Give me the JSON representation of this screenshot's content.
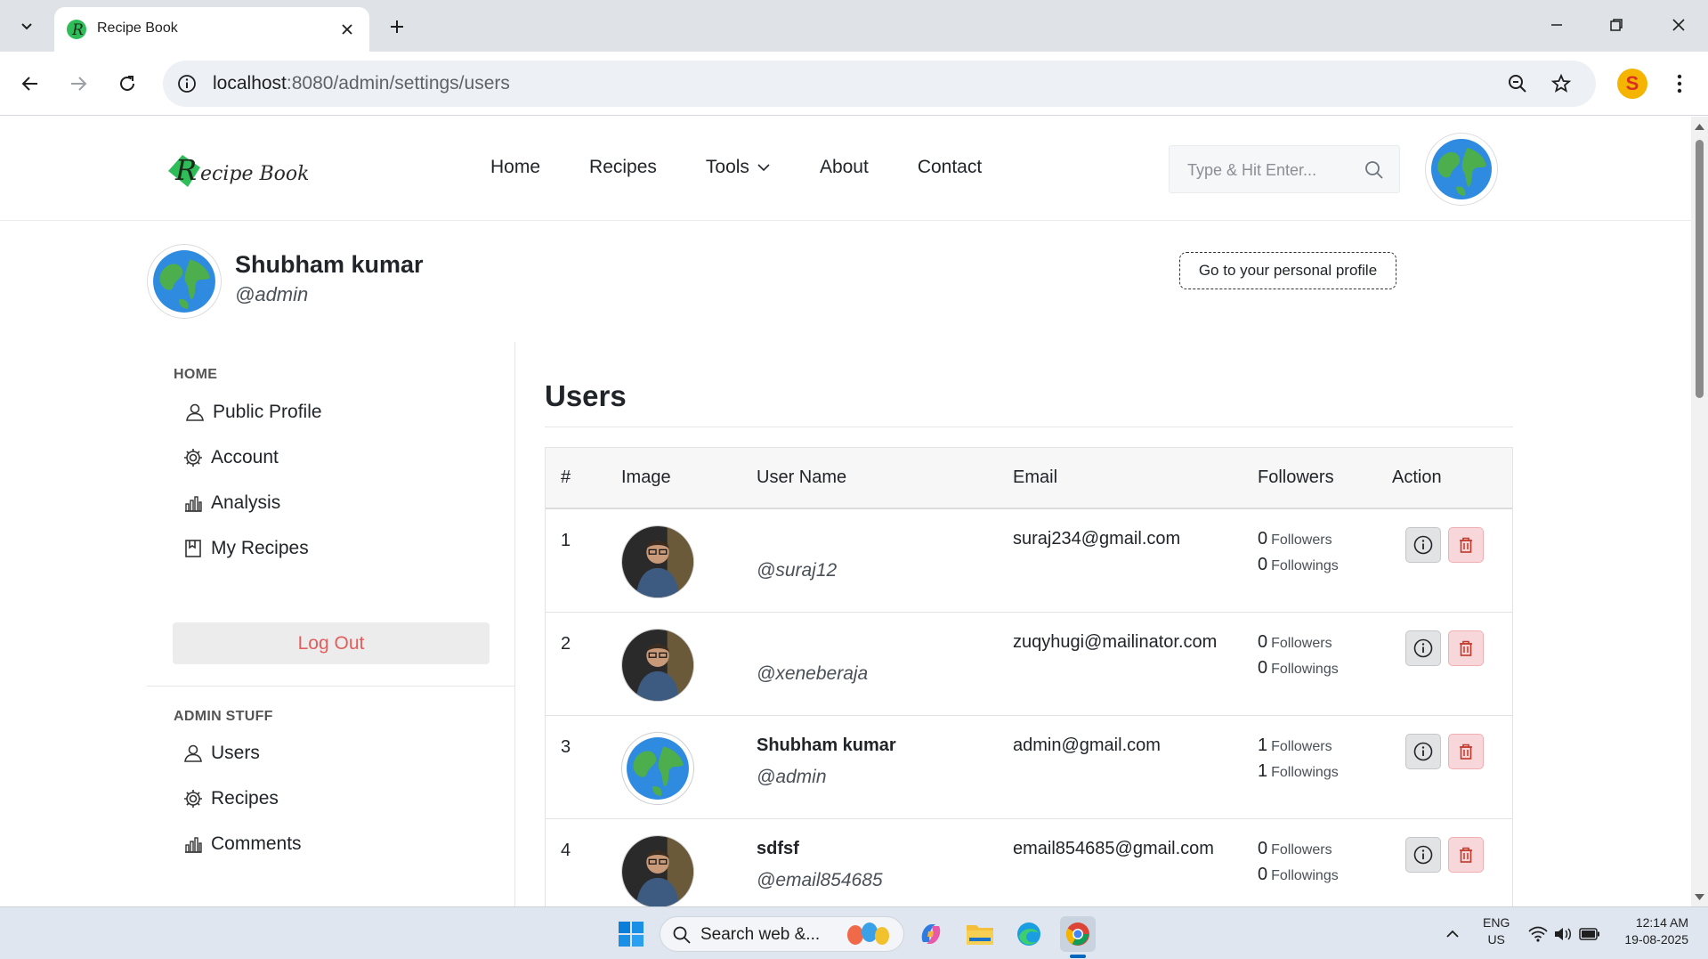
{
  "browser": {
    "tab_title": "Recipe Book",
    "url_host": "localhost",
    "url_path": ":8080/admin/settings/users"
  },
  "site": {
    "logo_text": "ecipe Book",
    "nav": [
      "Home",
      "Recipes",
      "Tools",
      "About",
      "Contact"
    ],
    "search_placeholder": "Type & Hit Enter..."
  },
  "profile": {
    "name": "Shubham kumar",
    "handle": "@admin",
    "personal_profile_button": "Go to your personal profile"
  },
  "sidebar": {
    "home_heading": "HOME",
    "home_items": [
      {
        "label": "Public Profile",
        "icon": "user-icon"
      },
      {
        "label": "Account",
        "icon": "gear-icon"
      },
      {
        "label": "Analysis",
        "icon": "bar-chart-icon"
      },
      {
        "label": "My Recipes",
        "icon": "bookmark-icon"
      }
    ],
    "logout_label": "Log Out",
    "admin_heading": "ADMIN STUFF",
    "admin_items": [
      {
        "label": "Users",
        "icon": "user-icon"
      },
      {
        "label": "Recipes",
        "icon": "gear-icon"
      },
      {
        "label": "Comments",
        "icon": "bar-chart-icon"
      }
    ]
  },
  "users_page": {
    "title": "Users",
    "columns": [
      "#",
      "Image",
      "User Name",
      "Email",
      "Followers",
      "Action"
    ],
    "followers_suffix": "Followers",
    "followings_suffix": "Followings",
    "rows": [
      {
        "index": "1",
        "avatar": "person-photo",
        "name": "",
        "handle": "@suraj12",
        "email": "suraj234@gmail.com",
        "followers": "0",
        "followings": "0"
      },
      {
        "index": "2",
        "avatar": "person-photo",
        "name": "",
        "handle": "@xeneberaja",
        "email": "zuqyhugi@mailinator.com",
        "followers": "0",
        "followings": "0"
      },
      {
        "index": "3",
        "avatar": "globe",
        "name": "Shubham kumar",
        "handle": "@admin",
        "email": "admin@gmail.com",
        "followers": "1",
        "followings": "1"
      },
      {
        "index": "4",
        "avatar": "person-photo",
        "name": "sdfsf",
        "handle": "@email854685",
        "email": "email854685@gmail.com",
        "followers": "0",
        "followings": "0"
      }
    ]
  },
  "taskbar": {
    "search_text": "Search web &...",
    "lang": "ENG",
    "region": "US",
    "time": "12:14 AM",
    "date": "19-08-2025"
  },
  "colors": {
    "accent_green": "#2ebd59",
    "logout_red": "#e35d5d",
    "delete_bg": "#f8d7da",
    "info_bg": "#e2e3e5"
  }
}
